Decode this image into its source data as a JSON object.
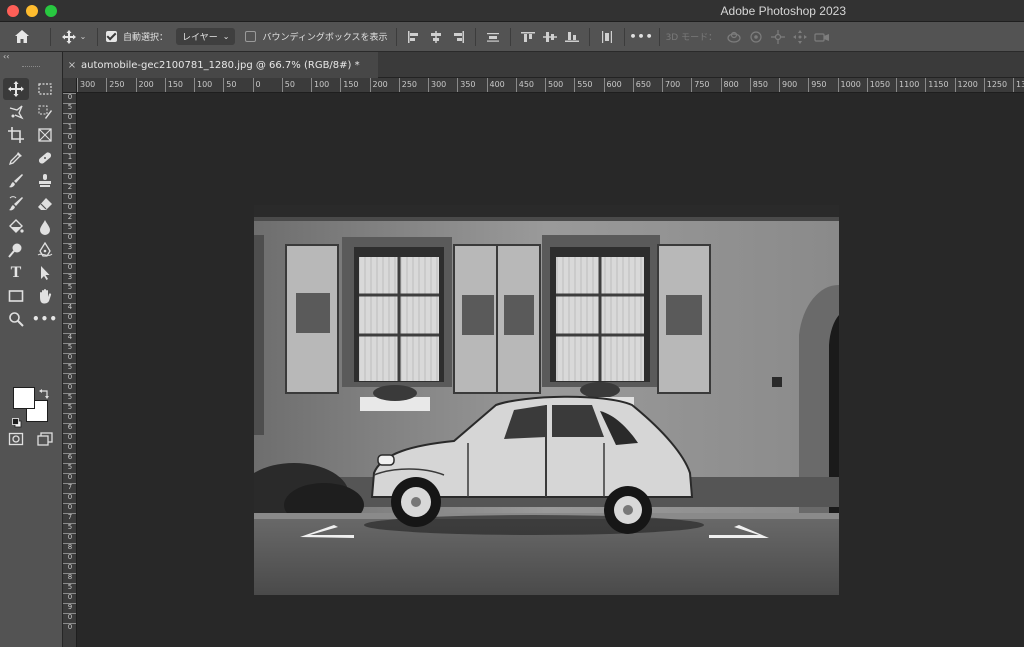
{
  "app": {
    "title": "Adobe Photoshop 2023"
  },
  "options_bar": {
    "auto_select_label": "自動選択：",
    "auto_select_target": "レイヤー",
    "bounding_box_label": "バウンディングボックスを表示",
    "mode_3d_label": "3D モード：",
    "more_label": "•••"
  },
  "document": {
    "tab_title": "automobile-gec2100781_1280.jpg @ 66.7% (RGB/8#) *",
    "close_label": "×"
  },
  "ruler_top": [
    "300",
    "250",
    "200",
    "150",
    "100",
    "50",
    "0",
    "50",
    "100",
    "150",
    "200",
    "250",
    "300",
    "350",
    "400",
    "450",
    "500",
    "550",
    "600",
    "650",
    "700",
    "750",
    "800",
    "850",
    "900",
    "950",
    "1000",
    "1050",
    "1100",
    "1150",
    "1200",
    "1250",
    "13"
  ],
  "ruler_left": [
    "0",
    "5",
    "0",
    "1",
    "0",
    "0",
    "1",
    "5",
    "0",
    "2",
    "0",
    "0",
    "2",
    "5",
    "0",
    "3",
    "0",
    "0",
    "3",
    "5",
    "0",
    "4",
    "0",
    "0",
    "4",
    "5",
    "0",
    "5",
    "0",
    "0",
    "5",
    "5",
    "0",
    "6",
    "0",
    "0",
    "6",
    "5",
    "0",
    "7",
    "0",
    "0",
    "7",
    "5",
    "0",
    "8",
    "0",
    "0",
    "8",
    "5",
    "0",
    "9",
    "0",
    "0"
  ],
  "toolbar": {
    "collapse_label": "‹‹",
    "type_tool_label": "T",
    "more_tools_label": "•••"
  },
  "colors": {
    "app_bg": "#282828",
    "panel_bg": "#535353",
    "foreground_swatch": "#ffffff",
    "background_swatch": "#ffffff"
  }
}
